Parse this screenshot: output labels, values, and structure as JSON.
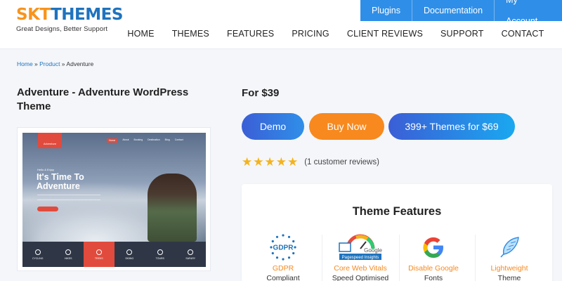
{
  "brand": {
    "logo_part1": "SKT",
    "logo_part2": "THEMES",
    "tagline": "Great Designs, Better Support",
    "orange": "#f7941d",
    "blue": "#1e73be"
  },
  "topbar": {
    "items": [
      "Plugins",
      "Documentation",
      "My Account"
    ],
    "bg_color": "#2f8fe8"
  },
  "nav": {
    "items": [
      "HOME",
      "THEMES",
      "FEATURES",
      "PRICING",
      "CLIENT REVIEWS",
      "SUPPORT",
      "CONTACT"
    ]
  },
  "breadcrumb": {
    "home": "Home",
    "sep1": " » ",
    "product": "Product",
    "sep2": " » ",
    "current": "Adventure"
  },
  "product": {
    "title": "Adventure - Adventure WordPress Theme",
    "price": "For $39",
    "rating_stars": "★★★★★",
    "rating_value": 5,
    "reviews": "(1 customer reviews)"
  },
  "preview": {
    "logo": "Adventure",
    "nav": [
      "Home",
      "About",
      "Booking",
      "Destination",
      "Blog",
      "Contact"
    ],
    "kicker": "Hello & Enjoy",
    "headline": "It's Time To Adventure",
    "bar": [
      "CYCLING",
      "HIKES",
      "TREKS",
      "SKIING",
      "TOURS",
      "SAFARY"
    ]
  },
  "buttons": {
    "demo": "Demo",
    "buy": "Buy Now",
    "bundle": "399+ Themes for $69"
  },
  "features": {
    "title": "Theme Features",
    "items": [
      {
        "label": "GDPR",
        "sub": "Compliant",
        "icon": "gdpr-stars-icon"
      },
      {
        "label": "Core Web Vitals",
        "sub": "Speed Optimised",
        "icon": "pagespeed-gauge-icon"
      },
      {
        "label": "Disable Google",
        "sub": "Fonts",
        "icon": "google-g-icon"
      },
      {
        "label": "Lightweight",
        "sub": "Theme",
        "icon": "feather-icon"
      }
    ],
    "badge_text": "GDPR",
    "pagespeed_caption": "Pagespeed Insights",
    "google_word": "Google"
  }
}
